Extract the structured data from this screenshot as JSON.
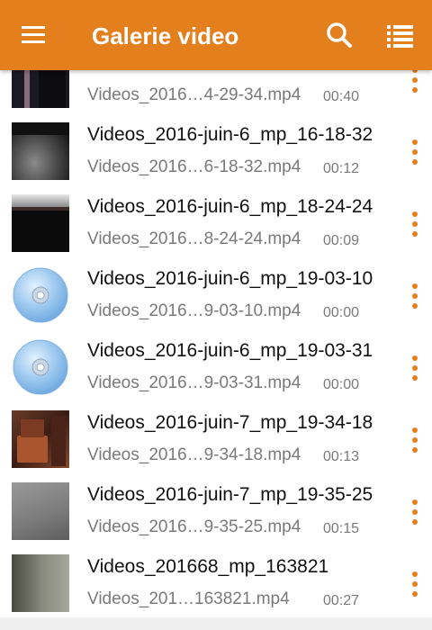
{
  "app_bar": {
    "title": "Galerie video",
    "background": "#e47f1e",
    "icons": [
      "menu-icon",
      "search-icon",
      "list-view-icon"
    ]
  },
  "videos": [
    {
      "name": "",
      "file": "Videos_2016…4-29-34.mp4",
      "duration": "00:40",
      "thumb": "dark-scene"
    },
    {
      "name": "Videos_2016-juin-6_mp_16-18-32",
      "file": "Videos_2016…6-18-32.mp4",
      "duration": "00:12",
      "thumb": "dark-gray-scene"
    },
    {
      "name": "Videos_2016-juin-6_mp_18-24-24",
      "file": "Videos_2016…8-24-24.mp4",
      "duration": "00:09",
      "thumb": "black-scene"
    },
    {
      "name": "Videos_2016-juin-6_mp_19-03-10",
      "file": "Videos_2016…9-03-10.mp4",
      "duration": "00:00",
      "thumb": "disc-icon"
    },
    {
      "name": "Videos_2016-juin-6_mp_19-03-31",
      "file": "Videos_2016…9-03-31.mp4",
      "duration": "00:00",
      "thumb": "disc-icon"
    },
    {
      "name": "Videos_2016-juin-7_mp_19-34-18",
      "file": "Videos_2016…9-34-18.mp4",
      "duration": "00:13",
      "thumb": "chair-scene"
    },
    {
      "name": "Videos_2016-juin-7_mp_19-35-25",
      "file": "Videos_2016…9-35-25.mp4",
      "duration": "00:15",
      "thumb": "gray-scene"
    },
    {
      "name": "Videos_201668_mp_163821",
      "file": "Videos_201…163821.mp4",
      "duration": "00:27",
      "thumb": "gray-green-scene"
    }
  ]
}
